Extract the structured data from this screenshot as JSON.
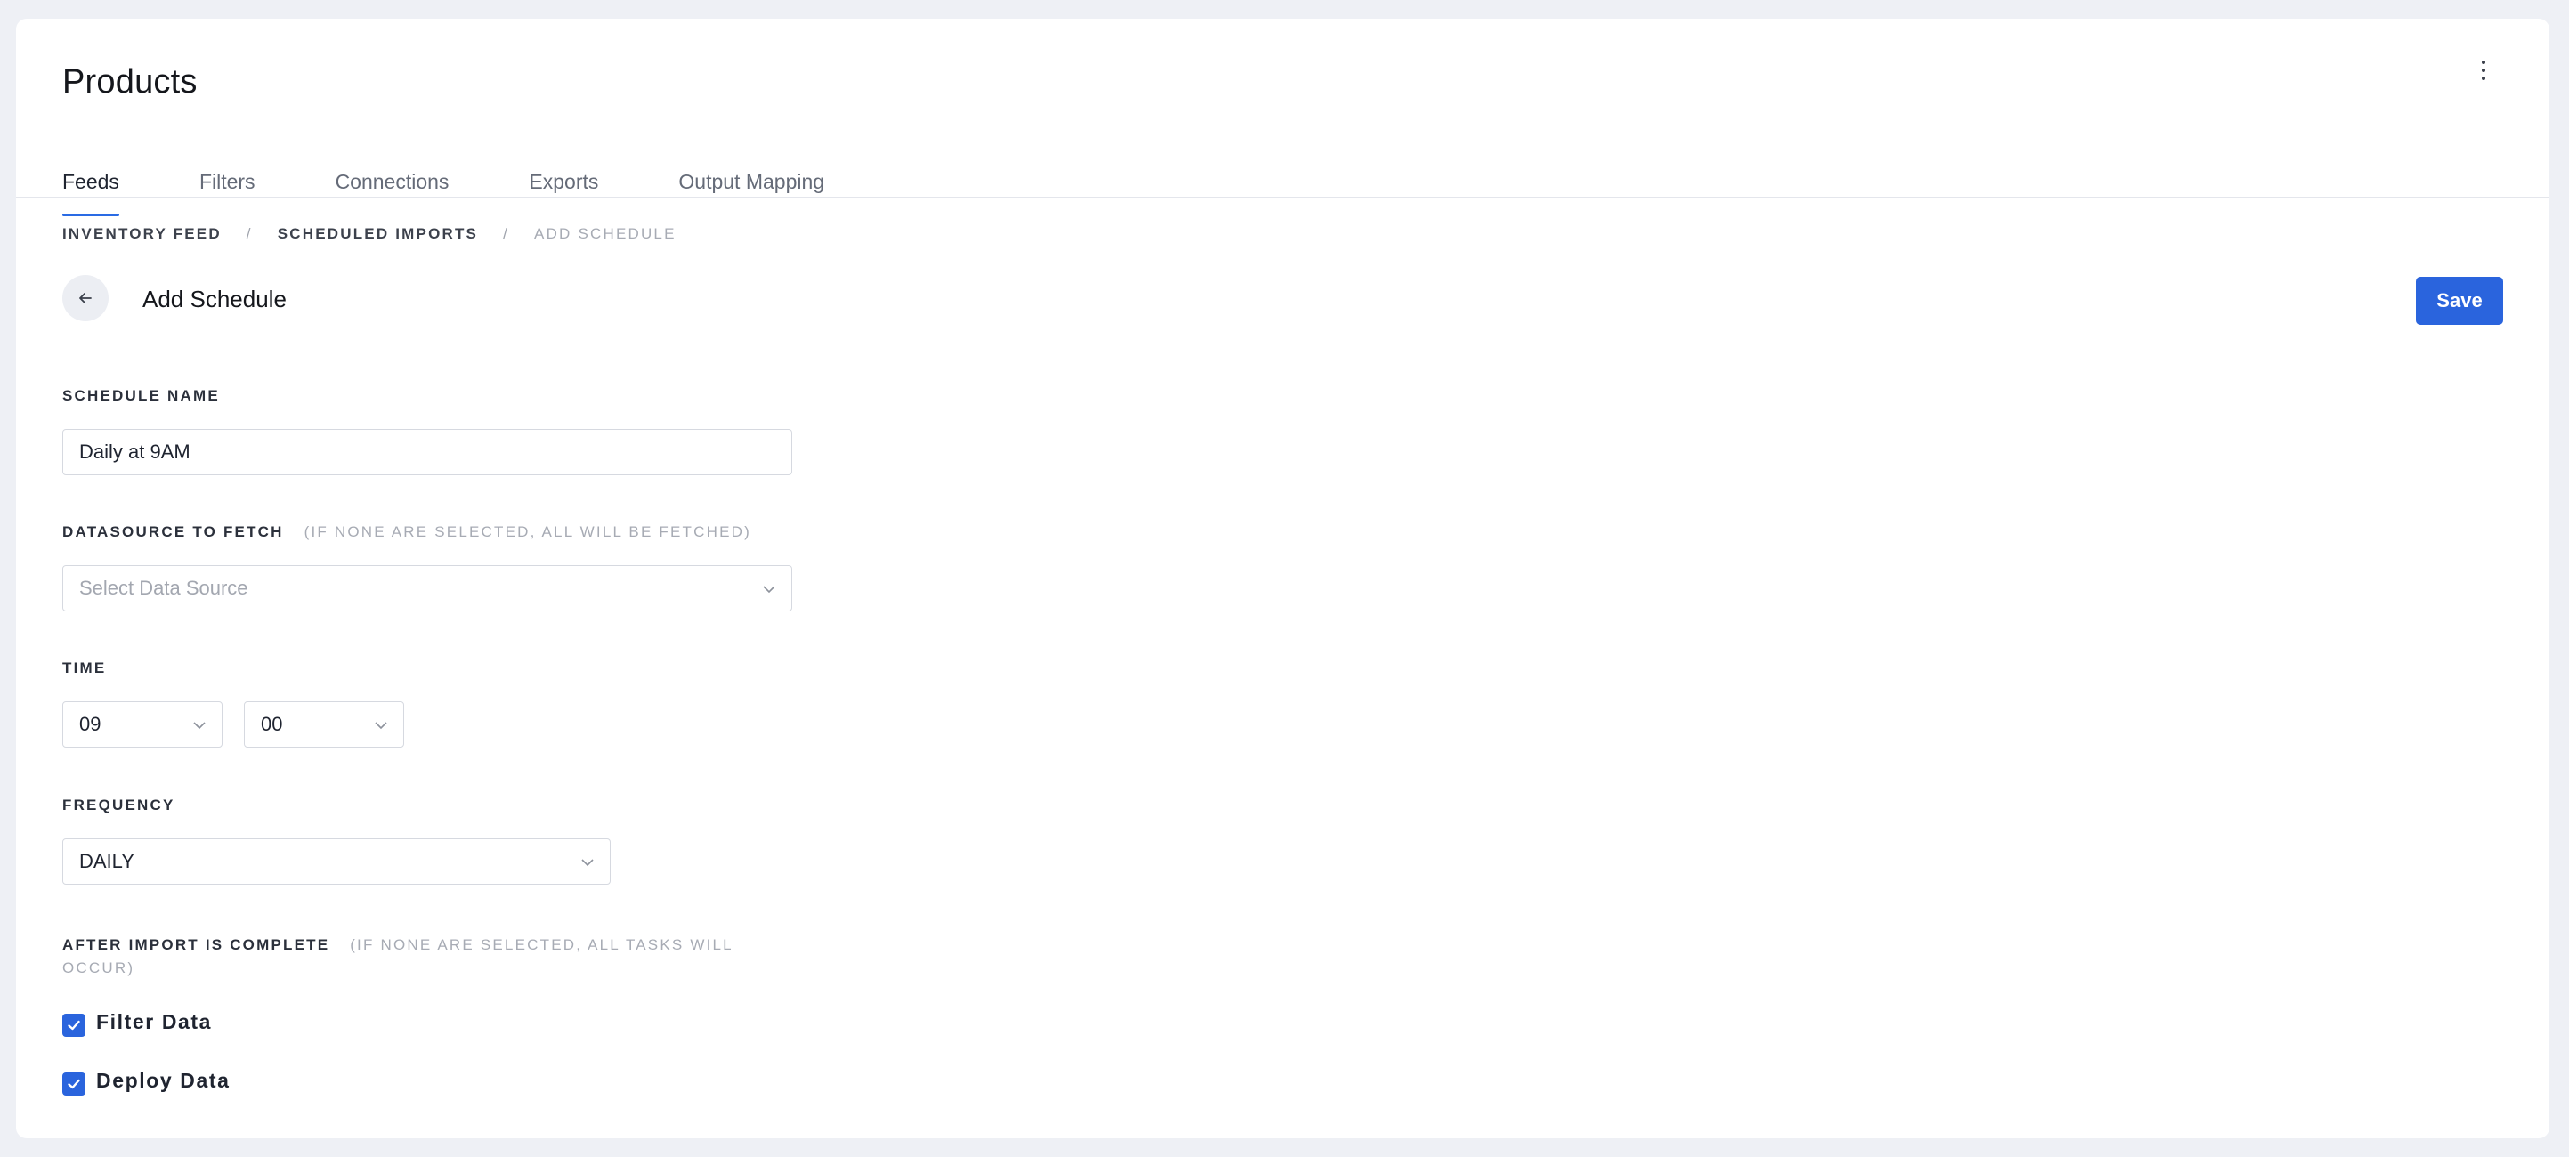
{
  "header": {
    "title": "Products",
    "more_icon": "more-vertical-icon"
  },
  "tabs": [
    {
      "label": "Feeds",
      "active": true
    },
    {
      "label": "Filters"
    },
    {
      "label": "Connections"
    },
    {
      "label": "Exports"
    },
    {
      "label": "Output Mapping"
    }
  ],
  "breadcrumb": {
    "items": [
      "INVENTORY FEED",
      "SCHEDULED IMPORTS",
      "ADD SCHEDULE"
    ],
    "separator": "/"
  },
  "page": {
    "title": "Add Schedule",
    "back_icon": "arrow-left-icon",
    "save_label": "Save"
  },
  "form": {
    "schedule_name": {
      "label": "SCHEDULE NAME",
      "value": "Daily at 9AM"
    },
    "datasource": {
      "label": "DATASOURCE TO FETCH",
      "hint": "(IF NONE ARE SELECTED, ALL WILL BE FETCHED)",
      "placeholder": "Select Data Source"
    },
    "time": {
      "label": "TIME",
      "hour": "09",
      "minute": "00"
    },
    "frequency": {
      "label": "FREQUENCY",
      "value": "DAILY"
    },
    "after_import": {
      "label": "AFTER IMPORT IS COMPLETE",
      "hint_line1": "(IF NONE ARE SELECTED, ALL TASKS WILL",
      "hint_line2": "OCCUR)",
      "options": [
        {
          "label": "Filter Data",
          "checked": true
        },
        {
          "label": "Deploy Data",
          "checked": true
        }
      ]
    }
  },
  "colors": {
    "accent": "#2a64dd",
    "background": "#eef0f5"
  }
}
